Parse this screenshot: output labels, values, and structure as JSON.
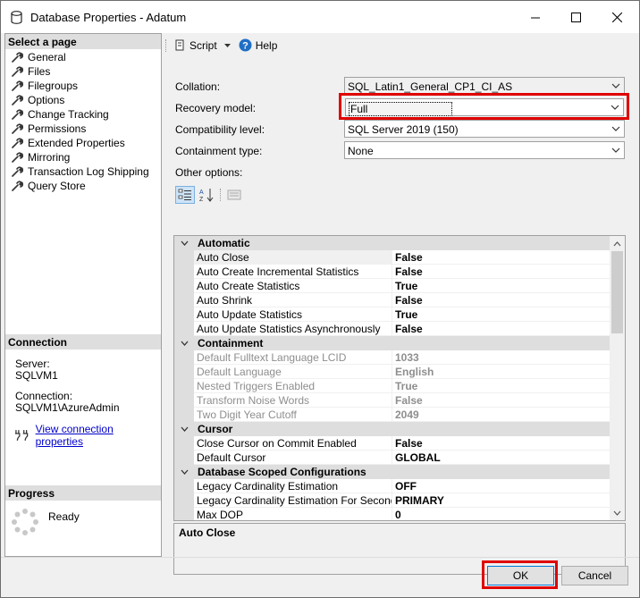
{
  "window": {
    "title": "Database Properties - Adatum"
  },
  "left": {
    "select_page_label": "Select a page",
    "pages": [
      "General",
      "Files",
      "Filegroups",
      "Options",
      "Change Tracking",
      "Permissions",
      "Extended Properties",
      "Mirroring",
      "Transaction Log Shipping",
      "Query Store"
    ],
    "connection_label": "Connection",
    "server_label": "Server:",
    "server_value": "SQLVM1",
    "connection_field_label": "Connection:",
    "connection_value": "SQLVM1\\AzureAdmin",
    "view_link": "View connection properties",
    "progress_label": "Progress",
    "progress_status": "Ready"
  },
  "toolbar": {
    "script_label": "Script",
    "help_label": "Help"
  },
  "form": {
    "collation_label": "Collation:",
    "collation_value": "SQL_Latin1_General_CP1_CI_AS",
    "recovery_label": "Recovery model:",
    "recovery_value": "Full",
    "compat_label": "Compatibility level:",
    "compat_value": "SQL Server 2019 (150)",
    "containment_label": "Containment type:",
    "containment_value": "None",
    "other_options_label": "Other options:"
  },
  "grid": {
    "categories": [
      {
        "name": "Automatic",
        "rows": [
          {
            "name": "Auto Close",
            "value": "False",
            "disabled": false,
            "selected": true
          },
          {
            "name": "Auto Create Incremental Statistics",
            "value": "False",
            "disabled": false
          },
          {
            "name": "Auto Create Statistics",
            "value": "True",
            "disabled": false
          },
          {
            "name": "Auto Shrink",
            "value": "False",
            "disabled": false
          },
          {
            "name": "Auto Update Statistics",
            "value": "True",
            "disabled": false
          },
          {
            "name": "Auto Update Statistics Asynchronously",
            "value": "False",
            "disabled": false
          }
        ]
      },
      {
        "name": "Containment",
        "rows": [
          {
            "name": "Default Fulltext Language LCID",
            "value": "1033",
            "disabled": true
          },
          {
            "name": "Default Language",
            "value": "English",
            "disabled": true
          },
          {
            "name": "Nested Triggers Enabled",
            "value": "True",
            "disabled": true
          },
          {
            "name": "Transform Noise Words",
            "value": "False",
            "disabled": true
          },
          {
            "name": "Two Digit Year Cutoff",
            "value": "2049",
            "disabled": true
          }
        ]
      },
      {
        "name": "Cursor",
        "rows": [
          {
            "name": "Close Cursor on Commit Enabled",
            "value": "False",
            "disabled": false
          },
          {
            "name": "Default Cursor",
            "value": "GLOBAL",
            "disabled": false
          }
        ]
      },
      {
        "name": "Database Scoped Configurations",
        "rows": [
          {
            "name": "Legacy Cardinality Estimation",
            "value": "OFF",
            "disabled": false
          },
          {
            "name": "Legacy Cardinality Estimation For Secondary",
            "value": "PRIMARY",
            "disabled": false
          },
          {
            "name": "Max DOP",
            "value": "0",
            "disabled": false
          }
        ]
      }
    ]
  },
  "description": {
    "title": "Auto Close"
  },
  "buttons": {
    "ok": "OK",
    "cancel": "Cancel"
  },
  "colors": {
    "highlight": "#e00000",
    "category_bg": "#dedede",
    "link": "#0000cc"
  }
}
